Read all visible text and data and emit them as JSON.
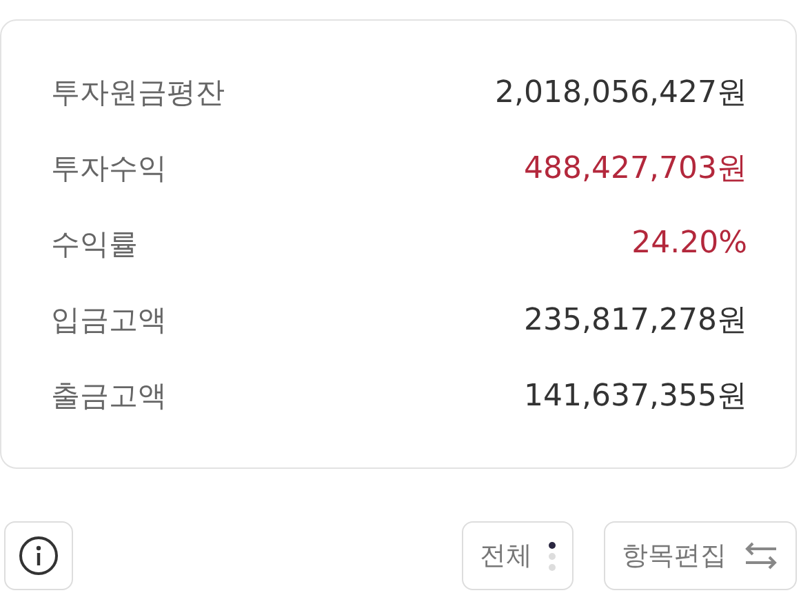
{
  "summary": [
    {
      "label": "투자원금평잔",
      "value": "2,018,056,427원",
      "color": "#333333"
    },
    {
      "label": "투자수익",
      "value": "488,427,703원",
      "color": "#b3283c"
    },
    {
      "label": "수익률",
      "value": "24.20%",
      "color": "#b3283c"
    },
    {
      "label": "입금고액",
      "value": "235,817,278원",
      "color": "#333333"
    },
    {
      "label": "출금고액",
      "value": "141,637,355원",
      "color": "#333333"
    }
  ],
  "filter_button": {
    "label": "전체",
    "dots": [
      {
        "selected": true
      },
      {
        "selected": false
      },
      {
        "selected": false
      }
    ]
  },
  "edit_button": {
    "label": "항목편집"
  }
}
